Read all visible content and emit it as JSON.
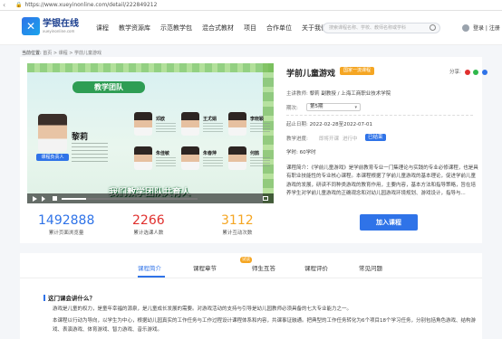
{
  "browser": {
    "url": "https://www.xueyinonline.com/detail/222849212"
  },
  "header": {
    "logo_title": "学银在线",
    "logo_sub": "xueyinonline.com",
    "nav": [
      "课程",
      "教学资源库",
      "示范教学包",
      "混合式教材",
      "项目",
      "合作单位",
      "关于我们"
    ],
    "search_placeholder": "搜索课程名称、学校、教师名称或学科",
    "login": "登录 | 注册"
  },
  "breadcrumb": {
    "label": "当前位置:",
    "path": "首页 > 课程 > 学前儿童游戏"
  },
  "video": {
    "banner": "教学团队",
    "leader_name": "黎莉",
    "leader_tag": "课程负责人",
    "members": [
      "邓欧",
      "王尤娟",
      "李晓颖",
      "朱佳敏",
      "朱春萍",
      "何鹊"
    ],
    "slogan": "我们教学团队共育人",
    "progress": 0.18
  },
  "stats": [
    {
      "value": "1492888",
      "label": "累计页面浏览量",
      "color": "#2f73e8"
    },
    {
      "value": "2266",
      "label": "累计选课人数",
      "color": "#e0302e"
    },
    {
      "value": "3112",
      "label": "累计互动次数",
      "color": "#f5a623"
    }
  ],
  "course": {
    "title": "学前儿童游戏",
    "badge": "国家一流课程",
    "share_label": "分享:",
    "teacher_key": "主讲教师:",
    "teacher_val": "黎莉 副教授 / 上海工商职业技术学院",
    "session_key": "期次:",
    "session_val": "第5期",
    "period_key": "起止日期:",
    "period_val": "2022-02-28至2022-07-01",
    "status_key": "教学进度:",
    "status_options": [
      "即将开课",
      "进行中",
      "已结束"
    ],
    "hours_val": "学时: 60学时",
    "intro": "课程简介：《学前儿童游戏》是学前教育专业一门集理论与实践的专业必修课程，也是具有职业技能性的专业核心课程。本课程根据了学前儿童游戏的基本理论，促进学前儿童游戏的发展，研读不同种类游戏的教育作用，主要内容，基本方法和指导策略，旨在培养学生对学前儿童游戏的正确观念和对幼儿园游戏环境规划、游戏设计，指导与...",
    "join_button": "加入课程"
  },
  "tabs": {
    "items": [
      "课程简介",
      "课程章节",
      "师生互答",
      "课程评价",
      "常见问题"
    ],
    "new_badge": "试读",
    "section_title": "这门课会讲什么？",
    "paragraphs": [
      "游戏是儿童的权力，是童年幸福的源泉，是儿童成长发展的需要。对游戏活动的支持与引导是幼儿园教师必须具备的七大专业能力之一。",
      "本课程以行动为导向，以学生为中心，根据幼儿园真实的工作任务与工作过程设计课程体系和内容，共课事证融通。把典型的工作任务转化为6个项目18个学习任务，分别包括角色游戏、结构游戏、表演游戏、体育游戏、智力游戏、音乐游戏。"
    ]
  }
}
